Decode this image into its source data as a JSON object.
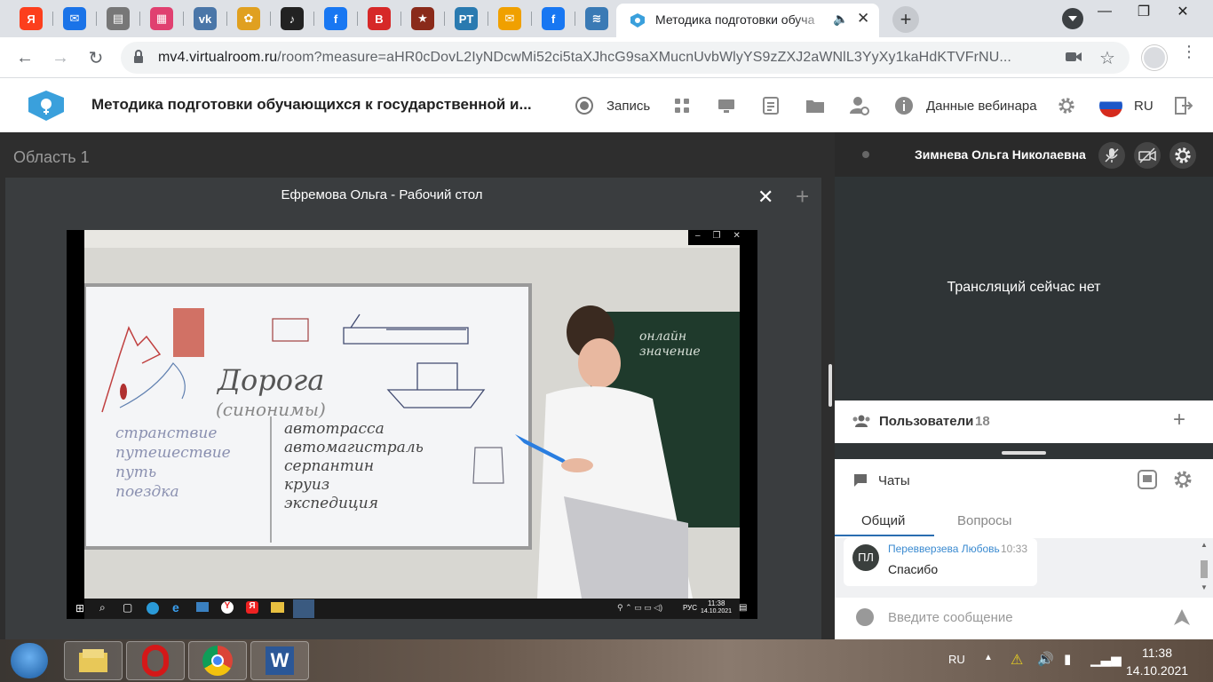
{
  "browser": {
    "tabs": [
      {
        "name": "yandex-tab",
        "glyph": "Я",
        "color": "#fc3f1d"
      },
      {
        "name": "mail-tab",
        "glyph": "✉",
        "color": "#1a73e8"
      },
      {
        "name": "doc-tab",
        "glyph": "▤",
        "color": "#777777"
      },
      {
        "name": "photo-tab",
        "glyph": "▦",
        "color": "#e04070"
      },
      {
        "name": "vk-tab",
        "glyph": "vk",
        "color": "#4a76a8"
      },
      {
        "name": "flower-tab",
        "glyph": "✿",
        "color": "#e0a020"
      },
      {
        "name": "music-tab",
        "glyph": "♪",
        "color": "#222222"
      },
      {
        "name": "facebook-tab",
        "glyph": "f",
        "color": "#1877f2"
      },
      {
        "name": "book-tab",
        "glyph": "B",
        "color": "#d62828"
      },
      {
        "name": "star-tab",
        "glyph": "★",
        "color": "#8a2a1a"
      },
      {
        "name": "rt-tab",
        "glyph": "PT",
        "color": "#2a7ab0"
      },
      {
        "name": "mail2-tab",
        "glyph": "✉",
        "color": "#f0a000"
      },
      {
        "name": "facebook2-tab",
        "glyph": "f",
        "color": "#1877f2"
      },
      {
        "name": "wave-tab",
        "glyph": "≋",
        "color": "#3a7ab5"
      }
    ],
    "active_tab_title": "Методика подготовки обуча",
    "url_host": "mv4.virtualroom.ru",
    "url_path": "/room?measure=aHR0cDovL2IyNDcwMi52ci5taXJhcG9saXMucnUvbWlyYS9zZXJ2aWNlL3YyXy1kaHdKTVFrNU..."
  },
  "app": {
    "title": "Методика подготовки обучающихся к государственной и...",
    "record_label": "Запись",
    "webinar_data_label": "Данные вебинара",
    "language": "RU",
    "area_title": "Область 1",
    "panel_title": "Ефремова Ольга - Рабочий стол",
    "speaker_name": "Зимнева Ольга Николаевна",
    "no_stream": "Трансляций сейчас нет",
    "users_label": "Пользователи",
    "users_count": "18",
    "chats_label": "Чаты",
    "chat_tabs": [
      "Общий",
      "Вопросы"
    ],
    "message": {
      "initials": "ПЛ",
      "author": "Перевверзева Любовь",
      "time": "10:33",
      "text": "Спасибо"
    },
    "input_placeholder": "Введите сообщение"
  },
  "shared_screen": {
    "board_title": "Дорога",
    "board_subtitle": "(синонимы)",
    "left_words": [
      "странствие",
      "путешествие",
      "путь",
      "поездка"
    ],
    "right_words": [
      "автотрасса",
      "автомагистраль",
      "серпантин",
      "круиз",
      "экспедиция"
    ],
    "chalk_words": [
      "онлайн",
      "значение"
    ],
    "inner_time": "11:38",
    "inner_date": "14.10.2021",
    "inner_lang": "РУС"
  },
  "taskbar": {
    "lang": "RU",
    "time": "11:38",
    "date": "14.10.2021"
  }
}
